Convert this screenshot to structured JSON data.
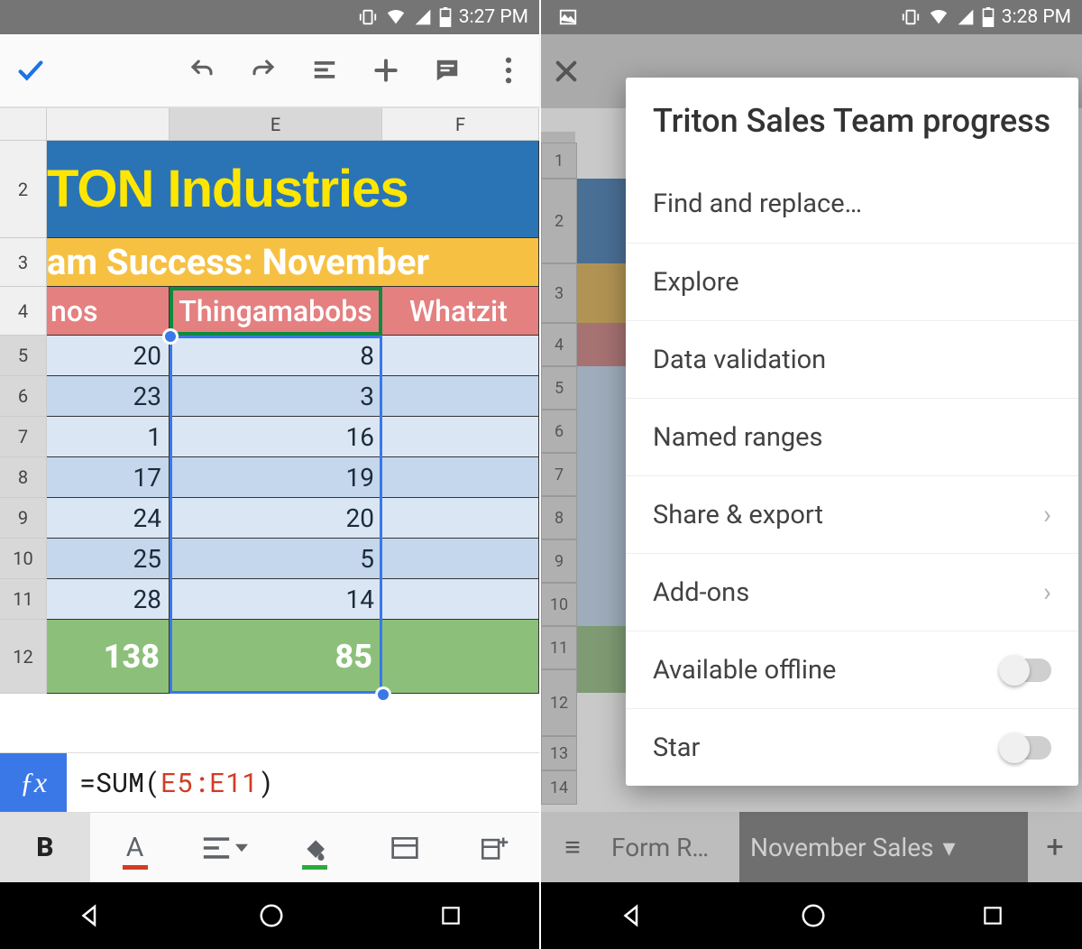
{
  "left": {
    "status_time": "3:27 PM",
    "col_headers": [
      "E",
      "F"
    ],
    "rows": [
      "2",
      "3",
      "4",
      "5",
      "6",
      "7",
      "8",
      "9",
      "10",
      "11",
      "12"
    ],
    "banner1": "TON Industries",
    "banner2": "am Success: November",
    "header_d": "nos",
    "header_e": "Thingamabobs",
    "header_f": "Whatzit",
    "data": {
      "d": [
        "20",
        "23",
        "1",
        "17",
        "24",
        "25",
        "28"
      ],
      "e": [
        "8",
        "3",
        "16",
        "19",
        "20",
        "5",
        "14"
      ]
    },
    "totals": {
      "d": "138",
      "e": "85"
    },
    "formula_prefix": "=SUM(",
    "formula_ref": "E5:E11",
    "formula_suffix": ")",
    "fmt": {
      "bold": "B",
      "font": "A"
    }
  },
  "right": {
    "status_time": "3:28 PM",
    "menu_title": "Triton Sales Team progress",
    "menu": {
      "find": "Find and replace…",
      "explore": "Explore",
      "datavalid": "Data validation",
      "named": "Named ranges",
      "share": "Share & export",
      "addons": "Add-ons",
      "offline": "Available offline",
      "star": "Star"
    },
    "rows": [
      "1",
      "2",
      "3",
      "4",
      "5",
      "6",
      "7",
      "8",
      "9",
      "10",
      "11",
      "12",
      "13",
      "14"
    ],
    "tabs": {
      "tab1": "Form R…",
      "tab2": "November Sales"
    }
  }
}
